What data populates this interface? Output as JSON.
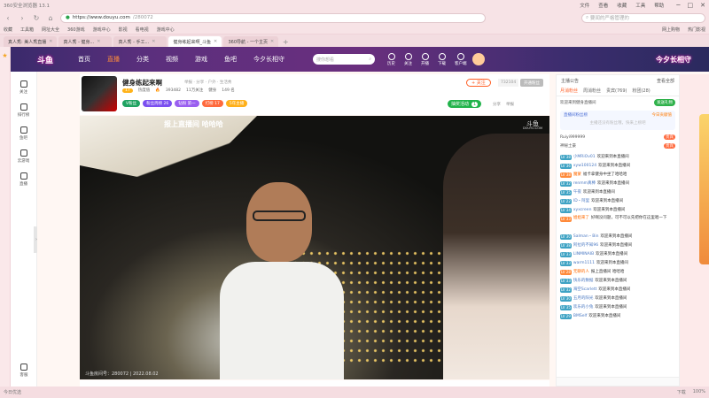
{
  "browser": {
    "title": "360安全浏览器 13.1",
    "menu": [
      "文件",
      "查看",
      "收藏",
      "工具",
      "帮助"
    ],
    "url_host": "https://www.douyu.com",
    "url_path": "/280072",
    "search_placeholder": "要闻的严格管理的",
    "bookmarks": [
      "收藏",
      "工具箱",
      "网址大全",
      "360游戏",
      "游戏中心",
      "影视",
      "看电视",
      "游戏中心"
    ],
    "bookmarks_right": [
      "网上购物",
      "热门影视"
    ],
    "tabs": [
      {
        "label": "真人秀: 美人秀直播",
        "active": false
      },
      {
        "label": "真人秀 - 健身...",
        "active": false
      },
      {
        "label": "真人秀 - 手工...",
        "active": false
      },
      {
        "label": "健身练起来啊_斗鱼",
        "active": true
      },
      {
        "label": "360导航 - 一个主页",
        "active": false
      }
    ],
    "status_left": "今日优选",
    "status_right": [
      "下载",
      "100%"
    ]
  },
  "douyu": {
    "logo": "斗鱼",
    "nav": [
      {
        "label": "首页",
        "active": false
      },
      {
        "label": "直播",
        "active": true
      },
      {
        "label": "分类",
        "active": false
      },
      {
        "label": "视频",
        "active": false
      },
      {
        "label": "游戏",
        "active": false
      },
      {
        "label": "鱼吧",
        "active": false
      },
      {
        "label": "今夕长相守",
        "active": false
      }
    ],
    "search_placeholder": "搜你想看",
    "header_icons": [
      "历史",
      "关注",
      "开播",
      "下载",
      "客户端"
    ],
    "header_right": "今夕长相守",
    "left_nav": [
      "关注",
      "排行榜",
      "鱼吧",
      "云游戏",
      "直播"
    ],
    "left_bottom": "客服"
  },
  "room": {
    "name": "健身练起来啊",
    "meta": "举报 · 分享 · 户外 · 生活秀",
    "level": "17",
    "hot_label": "热度值",
    "hot_value": "393482",
    "follows": "11万关注",
    "category": "健身",
    "rank": "149 名",
    "badges": [
      {
        "label": "V粉丝",
        "color": "#1fa361"
      },
      {
        "label": "粉丝周榜 26",
        "color": "#7b4ff0"
      },
      {
        "label": "钻粉 第一",
        "color": "#9a5ff0"
      },
      {
        "label": "打榜 17",
        "color": "#ff6a3d"
      },
      {
        "label": "5年主播",
        "color": "#ffb01a"
      }
    ],
    "follow_label": "+ 关注",
    "fans_count": "732104",
    "fans_button": "开通粉丝",
    "lottery_label": "抽奖活动",
    "lottery_count": "1",
    "share": "分享",
    "report": "举报"
  },
  "video": {
    "caption": "报上直播间 哈哈哈",
    "watermark": "斗鱼",
    "watermark_sub": "DOUYU.COM",
    "room_tag": "斗鱼房间号：280072 | 2022.08.02"
  },
  "chat": {
    "top_left": "主播公告",
    "top_right": "查看全部",
    "tabs": [
      {
        "label": "月消粉丝",
        "active": true
      },
      {
        "label": "周消粉丝",
        "active": false
      },
      {
        "label": "贵宾(769)",
        "active": false
      },
      {
        "label": "粉团(28)",
        "active": false
      }
    ],
    "notice_text": "欢迎来到健身直播间",
    "notice_button": "发送礼物",
    "rank_title": "直播间粉丝榜",
    "rank_right": "今日贡献值",
    "rank_sub": "主播还没有粉丝哦，快来上榜吧",
    "vip": [
      {
        "name": "Ruiyi999999",
        "tag": "贵宾"
      },
      {
        "name": "神秘土豪",
        "tag": "贵宾"
      }
    ],
    "messages": [
      {
        "lv": "LV 38",
        "name": "小MRiOv01",
        "text": "欢迎来到本直播间",
        "or": false,
        "tall": false
      },
      {
        "lv": "LV 36",
        "name": "xyw100124",
        "text": "欢迎来到本直播间",
        "or": false,
        "tall": false
      },
      {
        "lv": "LV 38",
        "name": "魔蒙",
        "text": "福卡拿健身中坐了哈哈哈",
        "or": true,
        "tall": false
      },
      {
        "lv": "LV 32",
        "name": "renmm真棒",
        "text": "欢迎来到本直播间",
        "or": false,
        "tall": false
      },
      {
        "lv": "LV 35",
        "name": "午夜",
        "text": "欢迎来到本直播间",
        "or": false,
        "tall": false
      },
      {
        "lv": "LV 22",
        "name": "ID・阿里",
        "text": "欢迎来到本直播间",
        "or": false,
        "tall": false
      },
      {
        "lv": "LV 34",
        "name": "xyxcreen",
        "text": "欢迎来到本直播间",
        "or": false,
        "tall": false
      },
      {
        "lv": "LV 33",
        "name": "姐姐来了",
        "text": "好啊没问题，可不可以先把你在这里唱一下",
        "or": true,
        "tall": true
      },
      {
        "lv": "LV 30",
        "name": "Salman・Bin",
        "text": "欢迎来到本直播间",
        "or": false,
        "tall": false
      },
      {
        "lv": "LV 38",
        "name": "阿拉的不知96",
        "text": "欢迎来到本直播间",
        "or": false,
        "tall": false
      },
      {
        "lv": "LV 33",
        "name": "LINMINAIB",
        "text": "欢迎来到本直播间",
        "or": false,
        "tall": false
      },
      {
        "lv": "LV 33",
        "name": "warm1111",
        "text": "欢迎来到本直播间",
        "or": false,
        "tall": false
      },
      {
        "lv": "LV 28",
        "name": "无聊的人",
        "text": "报上直播间 哈哈哈",
        "or": true,
        "tall": false
      },
      {
        "lv": "LV 33",
        "name": "快乐的数据",
        "text": "欢迎来到本直播间",
        "or": false,
        "tall": false
      },
      {
        "lv": "LV 32",
        "name": "海空Scarlett",
        "text": "欢迎来到本直播间",
        "or": false,
        "tall": false
      },
      {
        "lv": "LV 30",
        "name": "五月的阳光",
        "text": "欢迎来到本直播间",
        "or": false,
        "tall": false
      },
      {
        "lv": "LV 35",
        "name": "欢乐的小兔",
        "text": "欢迎来到本直播间",
        "or": false,
        "tall": false
      },
      {
        "lv": "LV 29",
        "name": "BMSelf",
        "text": "欢迎来到本直播间",
        "or": false,
        "tall": false
      }
    ]
  }
}
